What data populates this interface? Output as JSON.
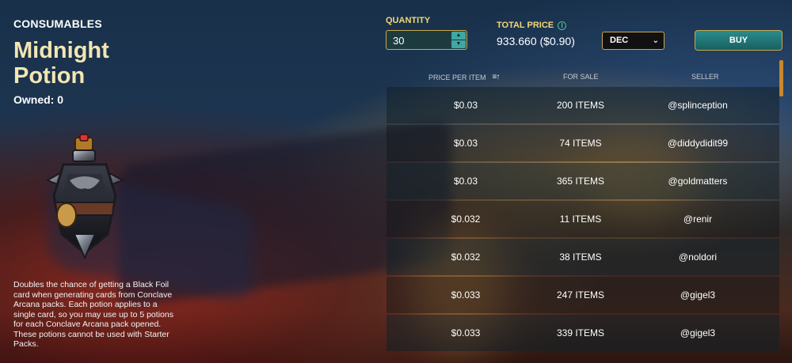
{
  "item": {
    "category": "CONSUMABLES",
    "title": "Midnight Potion",
    "owned_label": "Owned:",
    "owned_value": "0",
    "description": "Doubles the chance of getting a Black Foil card when generating cards from Conclave Arcana packs. Each potion applies to a single card, so you may use up to 5 potions for each Conclave Arcana pack opened. These potions cannot be used with Starter Packs.",
    "icon": "potion-bottle-icon"
  },
  "purchase": {
    "quantity_label": "QUANTITY",
    "quantity_value": "30",
    "total_label": "TOTAL PRICE",
    "total_value": "933.660 ($0.90)",
    "currency_selected": "DEC",
    "buy_label": "BUY"
  },
  "table": {
    "headers": {
      "price": "PRICE PER ITEM",
      "for_sale": "FOR SALE",
      "seller": "SELLER"
    },
    "rows": [
      {
        "price": "$0.03",
        "for_sale": "200 ITEMS",
        "seller": "@splinception"
      },
      {
        "price": "$0.03",
        "for_sale": "74 ITEMS",
        "seller": "@diddydidit99"
      },
      {
        "price": "$0.03",
        "for_sale": "365 ITEMS",
        "seller": "@goldmatters"
      },
      {
        "price": "$0.032",
        "for_sale": "11 ITEMS",
        "seller": "@renir"
      },
      {
        "price": "$0.032",
        "for_sale": "38 ITEMS",
        "seller": "@noldori"
      },
      {
        "price": "$0.033",
        "for_sale": "247 ITEMS",
        "seller": "@gigel3"
      },
      {
        "price": "$0.033",
        "for_sale": "339 ITEMS",
        "seller": "@gigel3"
      }
    ]
  },
  "colors": {
    "title_gold": "#f3e6b3",
    "label_gold": "#f0d878",
    "border_gold": "#c9a94e",
    "buy_teal": "#2b8c8d",
    "scrollbar": "#c9872e"
  }
}
